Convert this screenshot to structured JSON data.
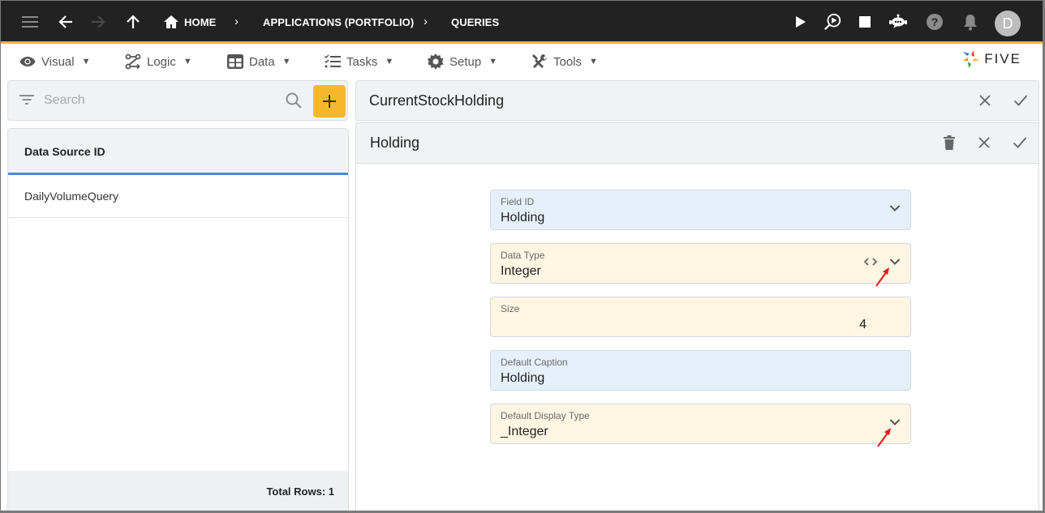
{
  "topbar": {
    "icons": {
      "menu": "hamburger-menu-icon",
      "back": "arrow-back-icon",
      "forward": "arrow-forward-icon",
      "up": "arrow-up-icon",
      "home": "home-icon",
      "run": "play-icon",
      "debug_run": "search-play-icon",
      "stop": "stop-icon",
      "assistant": "chatbot-icon",
      "help": "help-icon",
      "notifications": "bell-icon"
    },
    "breadcrumbs": [
      {
        "label": "HOME"
      },
      {
        "label": "APPLICATIONS (PORTFOLIO)"
      },
      {
        "label": "QUERIES"
      }
    ],
    "avatar_initial": "D",
    "accent_color": "#f4b52a"
  },
  "menubar": {
    "items": [
      {
        "label": "Visual",
        "caret": "▼"
      },
      {
        "label": "Logic",
        "caret": "▼"
      },
      {
        "label": "Data",
        "caret": "▼"
      },
      {
        "label": "Tasks",
        "caret": "▼"
      },
      {
        "label": "Setup",
        "caret": "▼"
      },
      {
        "label": "Tools",
        "caret": "▼"
      }
    ],
    "logo_text": "FIVE"
  },
  "left_panel": {
    "search": {
      "placeholder": "Search",
      "value": ""
    },
    "add_button_label": "+",
    "table": {
      "columns": [
        "Data Source ID"
      ],
      "rows": [
        [
          "DailyVolumeQuery"
        ]
      ]
    },
    "footer": {
      "total_rows_label": "Total Rows: 1"
    }
  },
  "right_panel": {
    "parent_title": "CurrentStockHolding",
    "record_title": "Holding",
    "fields": [
      {
        "label": "Field ID",
        "value": "Holding",
        "type": "select"
      },
      {
        "label": "Data Type",
        "value": "Integer",
        "type": "select"
      },
      {
        "label": "Size",
        "value": "4",
        "type": "number"
      },
      {
        "label": "Default Caption",
        "value": "Holding",
        "type": "text"
      },
      {
        "label": "Default Display Type",
        "value": "_Integer",
        "type": "select"
      }
    ]
  }
}
